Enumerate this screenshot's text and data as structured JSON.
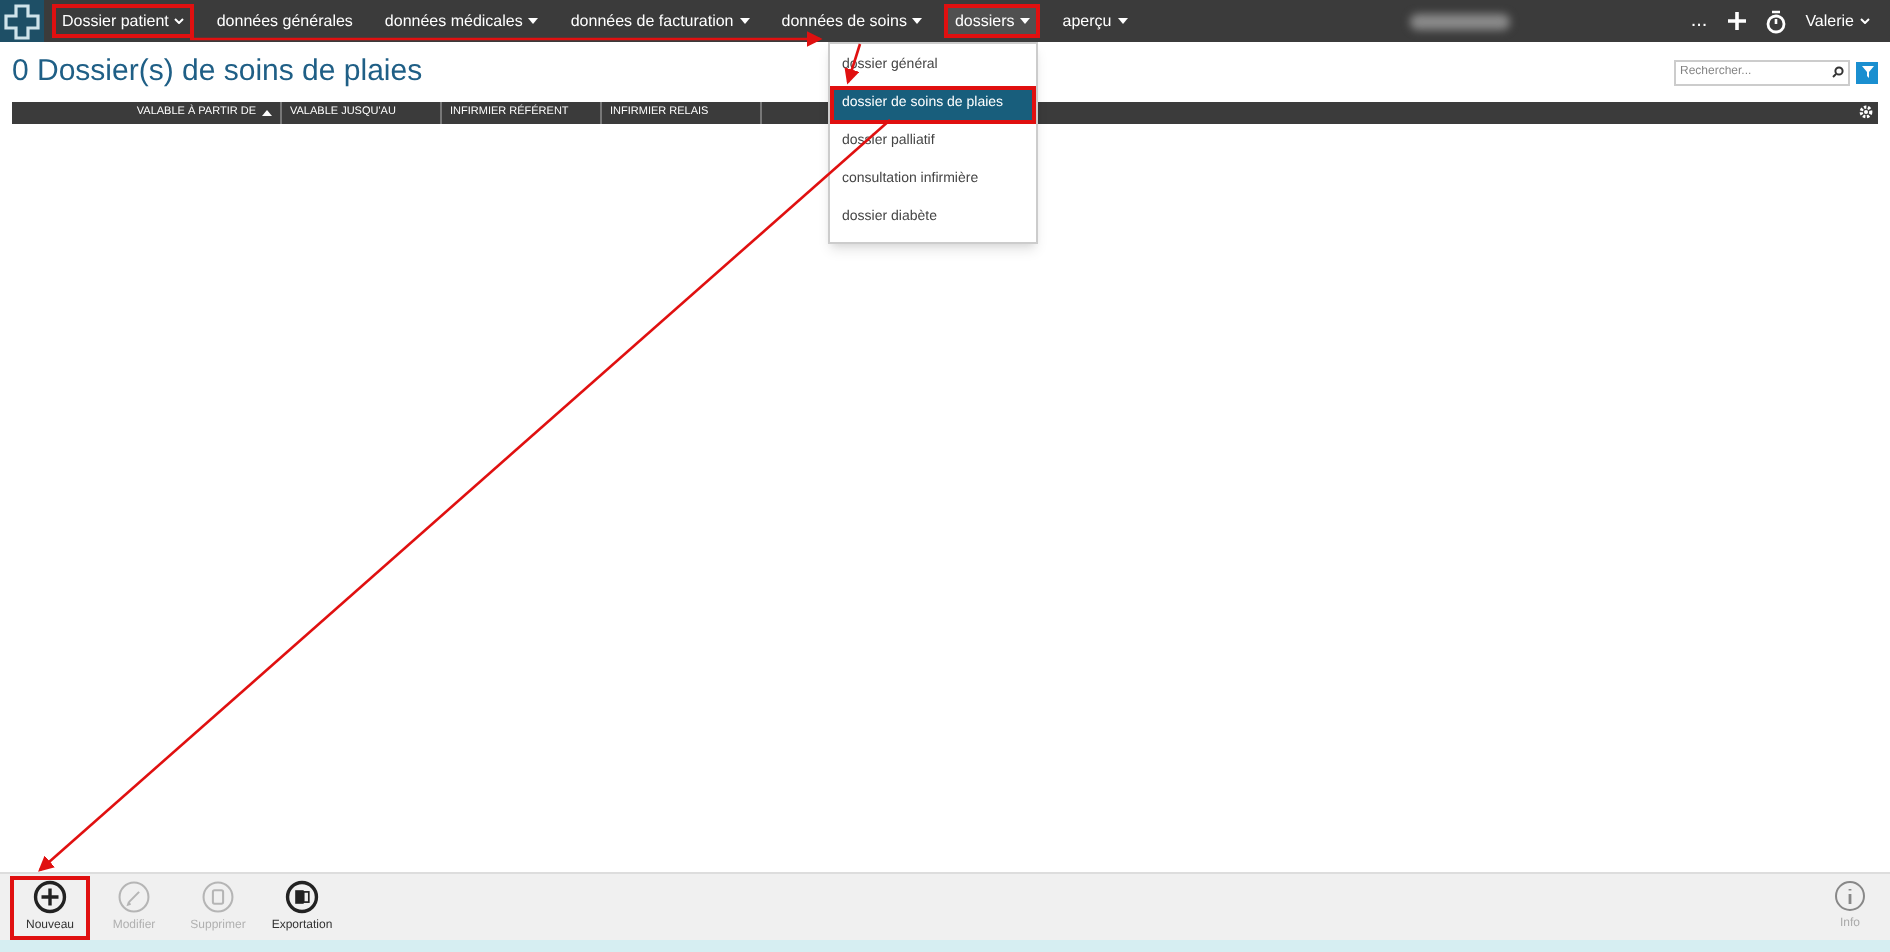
{
  "nav": {
    "items": [
      {
        "label": "Dossier patient",
        "kind": "primary",
        "annotated": true,
        "selected": false
      },
      {
        "label": "données générales",
        "kind": "plain",
        "annotated": false,
        "selected": false
      },
      {
        "label": "données médicales",
        "kind": "menu",
        "annotated": false,
        "selected": false
      },
      {
        "label": "données de facturation",
        "kind": "menu",
        "annotated": false,
        "selected": false
      },
      {
        "label": "données de soins",
        "kind": "menu",
        "annotated": false,
        "selected": false
      },
      {
        "label": "dossiers",
        "kind": "menu",
        "annotated": true,
        "selected": true
      },
      {
        "label": "aperçu",
        "kind": "menu",
        "annotated": false,
        "selected": false
      }
    ],
    "more": "...",
    "user": "Valerie"
  },
  "dropdown": {
    "items": [
      {
        "label": "dossier général",
        "selected": false,
        "annotated": false
      },
      {
        "label": "dossier de soins de plaies",
        "selected": true,
        "annotated": true
      },
      {
        "label": "dossier palliatif",
        "selected": false,
        "annotated": false
      },
      {
        "label": "consultation infirmière",
        "selected": false,
        "annotated": false
      },
      {
        "label": "dossier diabète",
        "selected": false,
        "annotated": false
      }
    ]
  },
  "page": {
    "title": "0 Dossier(s) de soins de plaies"
  },
  "search": {
    "placeholder": "Rechercher..."
  },
  "table": {
    "columns": [
      {
        "label": "VALABLE À PARTIR DE",
        "sorted": true
      },
      {
        "label": "VALABLE JUSQU'AU",
        "sorted": false
      },
      {
        "label": "INFIRMIER RÉFÉRENT",
        "sorted": false
      },
      {
        "label": "INFIRMIER RELAIS",
        "sorted": false
      }
    ]
  },
  "toolbar": {
    "buttons": [
      {
        "label": "Nouveau",
        "kind": "new",
        "disabled": false,
        "annotated": true
      },
      {
        "label": "Modifier",
        "kind": "edit",
        "disabled": true,
        "annotated": false
      },
      {
        "label": "Supprimer",
        "kind": "delete",
        "disabled": true,
        "annotated": false
      },
      {
        "label": "Exportation",
        "kind": "export",
        "disabled": false,
        "annotated": false
      }
    ],
    "info": "Info"
  }
}
